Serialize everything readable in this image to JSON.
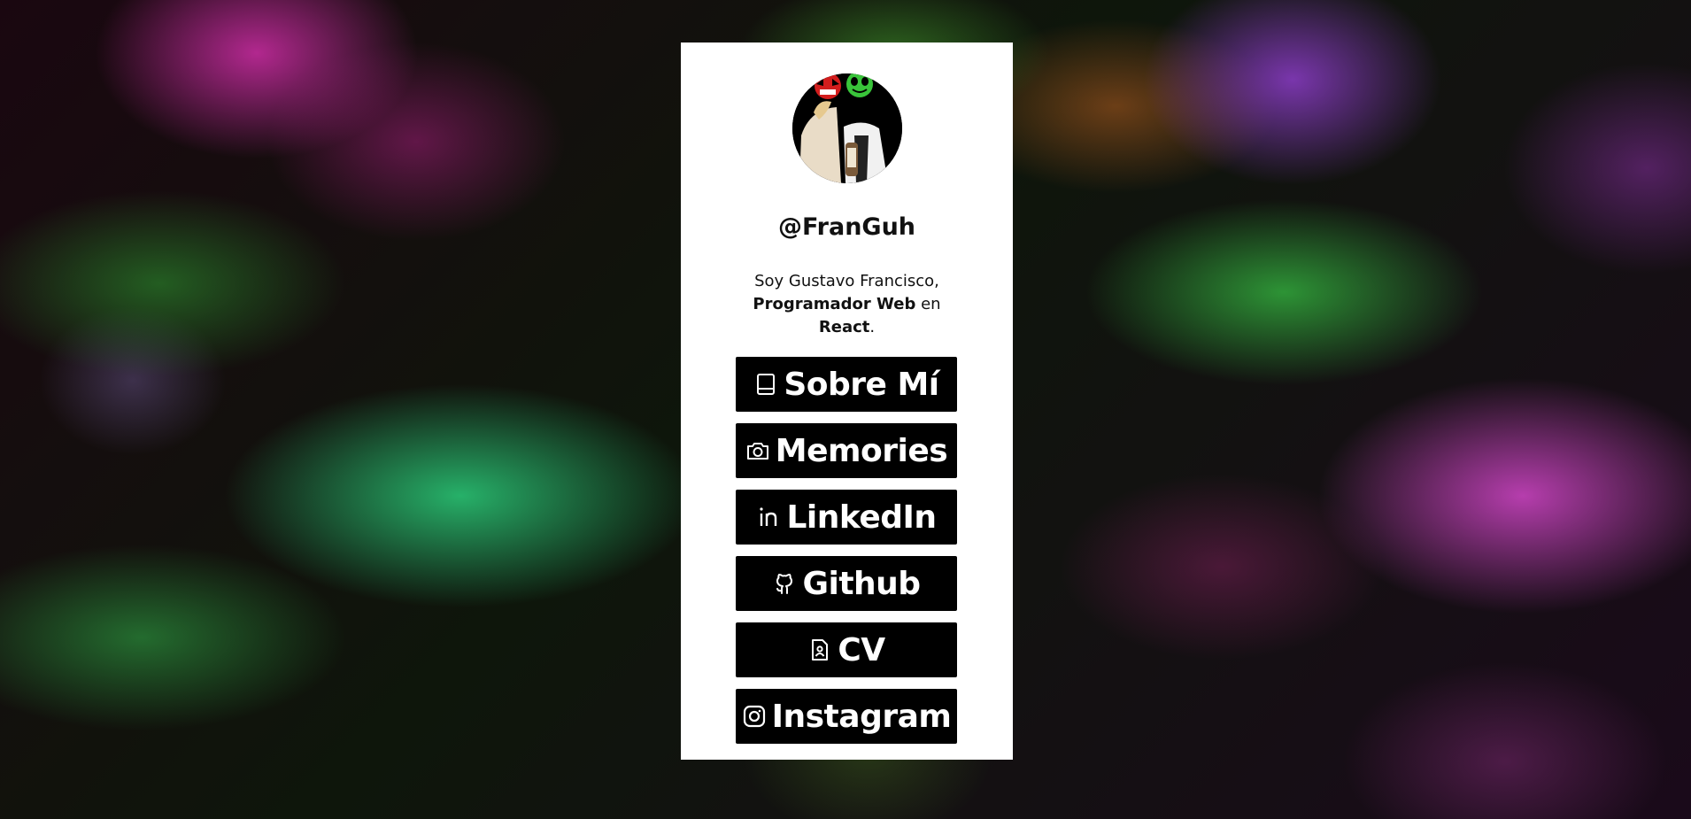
{
  "profile": {
    "username": "@FranGuh",
    "bio": {
      "line1": "Soy Gustavo Francisco,",
      "role": "Programador Web",
      "connector": " en",
      "tech": "React",
      "end": "."
    }
  },
  "links": [
    {
      "label": "Sobre Mí",
      "icon": "book-icon"
    },
    {
      "label": "Memories",
      "icon": "camera-icon"
    },
    {
      "label": "LinkedIn",
      "icon": "linkedin-icon"
    },
    {
      "label": "Github",
      "icon": "github-icon"
    },
    {
      "label": "CV",
      "icon": "resume-file-icon"
    },
    {
      "label": "Instagram",
      "icon": "instagram-icon"
    }
  ],
  "colors": {
    "card": "#ffffff",
    "button": "#000000",
    "button_text": "#ffffff"
  }
}
